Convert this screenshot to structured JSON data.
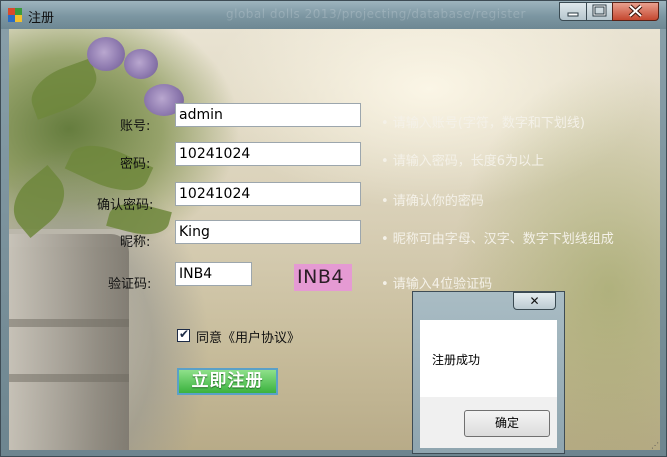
{
  "window": {
    "title": "注册",
    "background_title": "global dolls 2013/projecting/database/register"
  },
  "form": {
    "account": {
      "label": "账号:",
      "value": "admin",
      "hint": "• 请输入账号(字符，数字和下划线)"
    },
    "password": {
      "label": "密码:",
      "value": "10241024",
      "hint": "• 请输入密码，长度6为以上"
    },
    "confirm_password": {
      "label": "确认密码:",
      "value": "10241024",
      "hint": "• 请确认你的密码"
    },
    "nickname": {
      "label": "昵称:",
      "value": "King",
      "hint": "• 昵称可由字母、汉字、数字下划线组成"
    },
    "captcha": {
      "label": "验证码:",
      "value": "INB4",
      "image_text": "INB4",
      "hint": "• 请输入4位验证码"
    },
    "agreement": {
      "checked": true,
      "text": "同意《用户协议》"
    },
    "submit_label": "立即注册"
  },
  "message_box": {
    "text": "注册成功",
    "ok_label": "确定",
    "close_glyph": "✕"
  },
  "icons": {
    "window_icon": "app-icon",
    "minimize": "minimize-icon",
    "maximize": "maximize-icon",
    "close": "close-icon"
  },
  "colors": {
    "captcha_bg": "#e59ad3",
    "submit_bg": "#3bb23e",
    "hint_text": "#f4f1e8"
  }
}
